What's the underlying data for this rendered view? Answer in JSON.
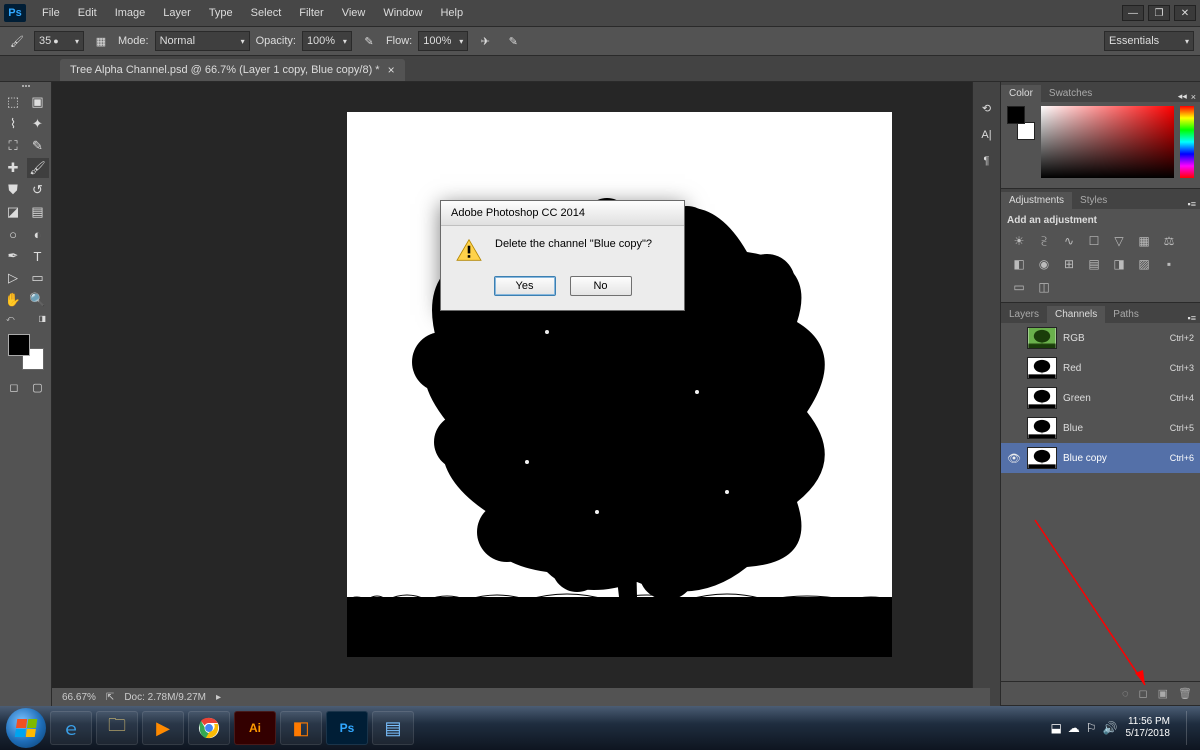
{
  "app": {
    "logo": "Ps"
  },
  "menus": [
    "File",
    "Edit",
    "Image",
    "Layer",
    "Type",
    "Select",
    "Filter",
    "View",
    "Window",
    "Help"
  ],
  "options": {
    "brush_size": "35",
    "mode_label": "Mode:",
    "mode_value": "Normal",
    "opacity_label": "Opacity:",
    "opacity_value": "100%",
    "flow_label": "Flow:",
    "flow_value": "100%"
  },
  "workspace": {
    "value": "Essentials"
  },
  "tab": {
    "title": "Tree Alpha Channel.psd @ 66.7% (Layer 1 copy, Blue copy/8) *"
  },
  "status": {
    "zoom": "66.67%",
    "doc": "Doc: 2.78M/9.27M"
  },
  "color_panel": {
    "tabs": [
      "Color",
      "Swatches"
    ]
  },
  "adjustments_panel": {
    "tabs": [
      "Adjustments",
      "Styles"
    ],
    "title": "Add an adjustment"
  },
  "layers_panel": {
    "tabs": [
      "Layers",
      "Channels",
      "Paths"
    ],
    "active_tab": 1,
    "channels": [
      {
        "name": "RGB",
        "shortcut": "Ctrl+2",
        "visible": false,
        "selected": false,
        "color": true
      },
      {
        "name": "Red",
        "shortcut": "Ctrl+3",
        "visible": false,
        "selected": false,
        "color": false
      },
      {
        "name": "Green",
        "shortcut": "Ctrl+4",
        "visible": false,
        "selected": false,
        "color": false
      },
      {
        "name": "Blue",
        "shortcut": "Ctrl+5",
        "visible": false,
        "selected": false,
        "color": false
      },
      {
        "name": "Blue copy",
        "shortcut": "Ctrl+6",
        "visible": true,
        "selected": true,
        "color": false
      }
    ]
  },
  "dialog": {
    "title": "Adobe Photoshop CC 2014",
    "message": "Delete the channel \"Blue copy\"?",
    "yes": "Yes",
    "no": "No"
  },
  "taskbar": {
    "time": "11:56 PM",
    "date": "5/17/2018"
  }
}
